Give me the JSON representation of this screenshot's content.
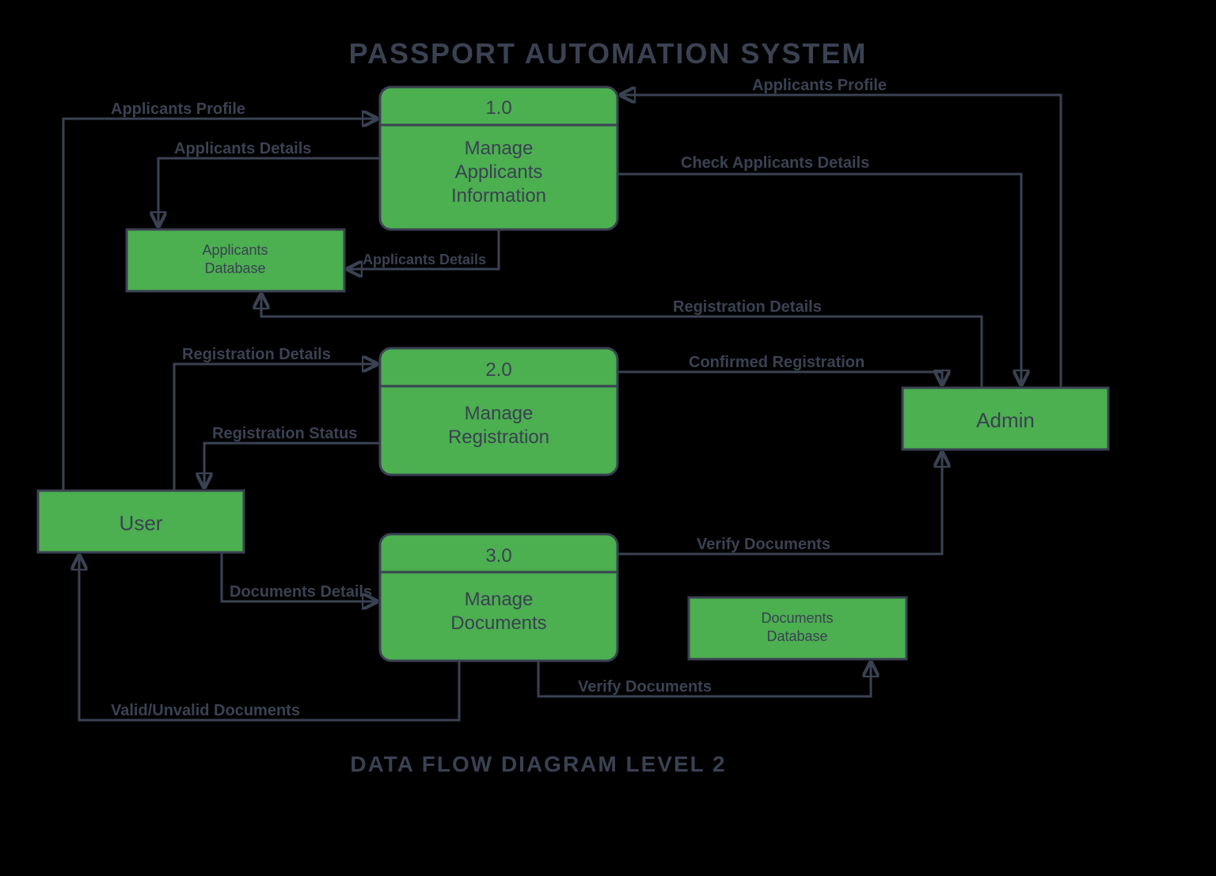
{
  "title": "PASSPORT AUTOMATION SYSTEM",
  "footer": "DATA FLOW DIAGRAM LEVEL 2",
  "entities": {
    "user": "User",
    "admin": "Admin"
  },
  "stores": {
    "applicants_db_l1": "Applicants",
    "applicants_db_l2": "Database",
    "documents_db_l1": "Documents",
    "documents_db_l2": "Database"
  },
  "processes": {
    "p1": {
      "num": "1.0",
      "l1": "Manage",
      "l2": "Applicants",
      "l3": "Information"
    },
    "p2": {
      "num": "2.0",
      "l1": "Manage",
      "l2": "Registration"
    },
    "p3": {
      "num": "3.0",
      "l1": "Manage",
      "l2": "Documents"
    }
  },
  "flows": {
    "user_p1": "Applicants Profile",
    "p1_db_left": "Applicants Details",
    "p1_db_down": "Applicants Details",
    "admin_p1_top": "Applicants Profile",
    "p1_admin": "Check Applicants Details",
    "admin_db": "Registration Details",
    "user_p2": "Registration Details",
    "p2_user": "Registration Status",
    "p2_admin": "Confirmed Registration",
    "user_p3": "Documents Details",
    "p3_admin": "Verify Documents",
    "p3_docdb": "Verify Documents",
    "p3_user": "Valid/Unvalid Documents"
  }
}
